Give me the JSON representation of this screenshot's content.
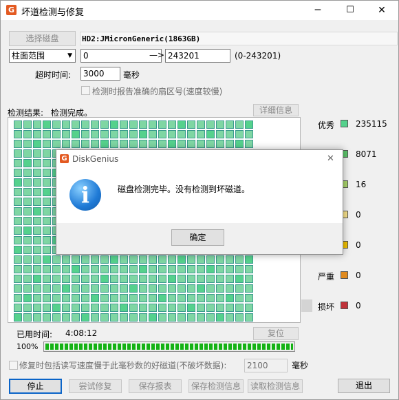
{
  "window": {
    "title": "坏道检测与修复",
    "app_icon_letter": "G",
    "minimize": "─",
    "maximize": "☐",
    "close": "✕"
  },
  "toolbar": {
    "select_disk_label": "选择磁盘",
    "disk_name": "HD2:JMicronGeneric(1863GB)",
    "range_mode": "柱面范围",
    "range_start": "0",
    "range_arrow": "—>",
    "range_end": "243201",
    "range_hint": "(0-243201)",
    "timeout_label": "超时时间:",
    "timeout_value": "3000",
    "timeout_unit": "毫秒",
    "report_sector_label": "检测时报告准确的扇区号(速度较慢)"
  },
  "result": {
    "label": "检测结果:",
    "status": "检测完成。",
    "details_button": "详细信息"
  },
  "grid": {
    "rows": 21,
    "cols": 25,
    "good_color": "#7fd6a3",
    "excellent_color": "#55d18c",
    "border_color": "#3a9b8e"
  },
  "legend": [
    {
      "name": "优秀",
      "count": "235115",
      "color": "#55d18c"
    },
    {
      "name": "",
      "count": "8071",
      "color": "#5cc46a"
    },
    {
      "name": "",
      "count": "16",
      "color": "#a8d36a"
    },
    {
      "name": "",
      "count": "0",
      "color": "#f5e08a"
    },
    {
      "name": "",
      "count": "0",
      "color": "#f0c000"
    },
    {
      "name": "严重",
      "count": "0",
      "color": "#e08a1e"
    },
    {
      "name": "损坏",
      "count": "0",
      "color": "#c0323a"
    }
  ],
  "elapsed": {
    "label": "已用时间:",
    "value": "4:08:12",
    "reset_button": "复位"
  },
  "progress": {
    "percent_label": "100%",
    "fraction": 1.0
  },
  "options": {
    "repair_label": "修复时包括读写速度慢于此毫秒数的好磁道(不破坏数据):",
    "threshold": "2100",
    "unit": "毫秒"
  },
  "buttons": {
    "stop": "停止",
    "try_repair": "尝试修复",
    "save_report": "保存报表",
    "save_check": "保存检测信息",
    "load_check": "读取检测信息",
    "exit": "退出"
  },
  "dialog": {
    "title": "DiskGenius",
    "message": "磁盘检测完毕。没有检测到坏磁道。",
    "ok": "确定",
    "close": "✕",
    "icon_glyph": "i"
  }
}
